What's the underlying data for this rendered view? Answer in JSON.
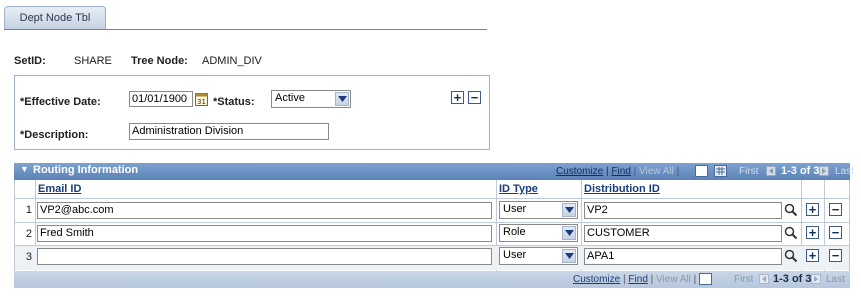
{
  "tab": {
    "label": "Dept Node Tbl"
  },
  "header": {
    "setid_label": "SetID:",
    "setid_value": "SHARE",
    "tree_node_label": "Tree Node:",
    "tree_node_value": "ADMIN_DIV"
  },
  "effdt": {
    "effective_date_label": "*Effective Date:",
    "effective_date_value": "01/01/1900",
    "status_label": "*Status:",
    "status_value": "Active",
    "description_label": "*Description:",
    "description_value": "Administration Division",
    "add_label": "+",
    "delete_label": "−"
  },
  "grid": {
    "title": "Routing Information",
    "customize": "Customize",
    "find": "Find",
    "view_all": "View All",
    "first": "First",
    "range": "1-3 of 3",
    "last": "Last",
    "columns": {
      "email": "Email ID",
      "id_type": "ID Type",
      "distribution": "Distribution ID"
    },
    "rows": [
      {
        "num": "1",
        "email": "VP2@abc.com",
        "id_type": "User",
        "distribution": "VP2"
      },
      {
        "num": "2",
        "email": "Fred Smith",
        "id_type": "Role",
        "distribution": "CUSTOMER"
      },
      {
        "num": "3",
        "email": "",
        "id_type": "User",
        "distribution": "APA1"
      }
    ],
    "footer": {
      "customize": "Customize",
      "find": "Find",
      "view_all": "View All",
      "first": "First",
      "range": "1-3 of 3",
      "last": "Last"
    }
  },
  "colors": {
    "grid_header": "#6d92c4",
    "link": "#1a3c7a",
    "border": "#9eb2c8"
  }
}
